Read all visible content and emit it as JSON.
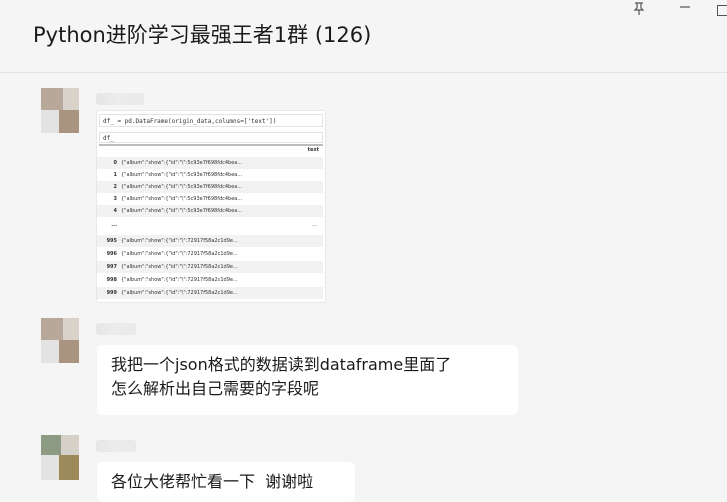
{
  "window": {
    "title": "Python进阶学习最强王者1群 (126)",
    "pin_icon": "pin-icon",
    "minimize_icon": "minimize-icon",
    "maximize_icon": "maximize-icon"
  },
  "messages": {
    "image_message": {
      "code_line": "df_ = pd.DataFrame(origin_data,columns=['text'])",
      "output_label": "df_",
      "column_header": "text",
      "rows": [
        {
          "index": "0",
          "value": "{\"album\":\"show\":{\"id\":\"\\\":5c93e7f698fdc4bea..."
        },
        {
          "index": "1",
          "value": "{\"album\":\"show\":{\"id\":\"\\\":5c93e7f698fdc4bea..."
        },
        {
          "index": "2",
          "value": "{\"album\":\"show\":{\"id\":\"\\\":5c93e7f698fdc4bea..."
        },
        {
          "index": "3",
          "value": "{\"album\":\"show\":{\"id\":\"\\\":5c93e7f698fdc4bea..."
        },
        {
          "index": "4",
          "value": "{\"album\":\"show\":{\"id\":\"\\\":5c93e7f698fdc4bea..."
        },
        {
          "index": "...",
          "value": "..."
        },
        {
          "index": "995",
          "value": "{\"album\":\"show\":{\"id\":\"\\\":72917f58a2c1d9e..."
        },
        {
          "index": "996",
          "value": "{\"album\":\"show\":{\"id\":\"\\\":72917f58a2c1d9e..."
        },
        {
          "index": "997",
          "value": "{\"album\":\"show\":{\"id\":\"\\\":72917f58a2c1d9e..."
        },
        {
          "index": "998",
          "value": "{\"album\":\"show\":{\"id\":\"\\\":72917f58a2c1d9e..."
        },
        {
          "index": "999",
          "value": "{\"album\":\"show\":{\"id\":\"\\\":72917f58a2c1d9e..."
        }
      ]
    },
    "text_message_1": {
      "line1": "我把一个json格式的数据读到dataframe里面了",
      "line2": "怎么解析出自己需要的字段呢"
    },
    "text_message_2": {
      "line1": "各位大佬帮忙看一下  谢谢啦"
    }
  },
  "colors": {
    "background": "#f5f5f5",
    "bubble": "#ffffff",
    "text": "#1a1a1a"
  }
}
